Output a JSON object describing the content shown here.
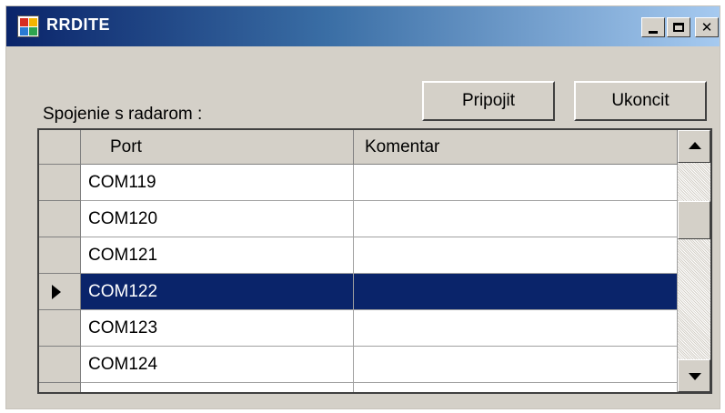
{
  "window": {
    "title": "RRDITE",
    "controls": {
      "minimize_icon": "minimize-icon",
      "maximize_icon": "maximize-icon",
      "close_label": "✕"
    }
  },
  "connection": {
    "label": "Spojenie s radarom :",
    "connect_label": "Pripojit",
    "disconnect_label": "Ukoncit"
  },
  "grid": {
    "columns": [
      "Port",
      "Komentar"
    ],
    "rows": [
      {
        "port": "COM119",
        "comment": ""
      },
      {
        "port": "COM120",
        "comment": ""
      },
      {
        "port": "COM121",
        "comment": ""
      },
      {
        "port": "COM122",
        "comment": "",
        "selected": true
      },
      {
        "port": "COM123",
        "comment": ""
      },
      {
        "port": "COM124",
        "comment": ""
      },
      {
        "port": "",
        "comment": ""
      }
    ],
    "selected_row_color": "#0a246a"
  },
  "colors": {
    "window_bg": "#d4d0c8",
    "title_gradient_start": "#0a246a",
    "title_gradient_end": "#a6caf0"
  }
}
